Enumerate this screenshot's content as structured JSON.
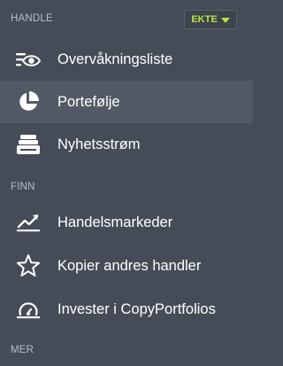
{
  "sections": {
    "trade": {
      "header": "HANDLE"
    },
    "discover": {
      "header": "FINN"
    },
    "more": {
      "header": "MER"
    }
  },
  "mode_badge": {
    "label": "EKTE",
    "color": "#b6e34a"
  },
  "nav": {
    "watchlist": {
      "label": "Overvåkningsliste",
      "icon": "eye-icon"
    },
    "portfolio": {
      "label": "Portefølje",
      "icon": "pie-chart-icon",
      "active": true
    },
    "newsfeed": {
      "label": "Nyhetsstrøm",
      "icon": "newsfeed-icon"
    },
    "markets": {
      "label": "Handelsmarkeder",
      "icon": "trend-chart-icon"
    },
    "copy_people": {
      "label": "Kopier andres handler",
      "icon": "star-icon"
    },
    "copyportfolios": {
      "label": "Invester i CopyPortfolios",
      "icon": "gauge-icon"
    }
  },
  "colors": {
    "background": "#464c57",
    "active_background": "#525964",
    "section_header": "#b7bcc4",
    "accent": "#b6e34a"
  }
}
